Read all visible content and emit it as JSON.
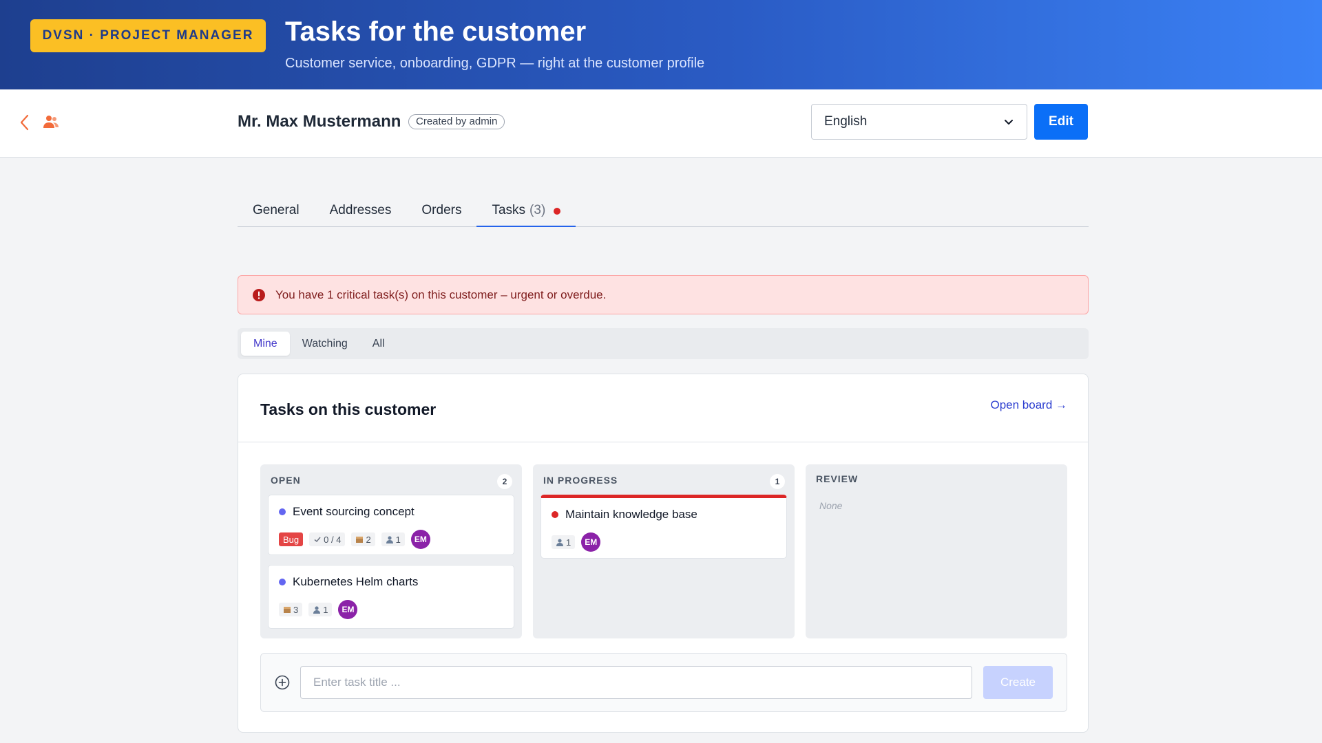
{
  "banner": {
    "brand": "DVSN · PROJECT MANAGER",
    "title": "Tasks for the customer",
    "subtitle": "Customer service, onboarding, GDPR — right at the customer profile"
  },
  "header": {
    "back_icon": "chevron-left-icon",
    "customer_icon": "users-icon",
    "customer_name": "Mr. Max Mustermann",
    "created_badge": "Created by admin",
    "language": "English",
    "edit_label": "Edit"
  },
  "tabs": [
    {
      "label": "General"
    },
    {
      "label": "Addresses"
    },
    {
      "label": "Orders"
    },
    {
      "label": "Tasks",
      "count": "(3)",
      "active": true
    }
  ],
  "alert": {
    "text": "You have 1 critical task(s) on this customer – urgent or overdue."
  },
  "filter": [
    {
      "label": "Mine",
      "active": true
    },
    {
      "label": "Watching"
    },
    {
      "label": "All"
    }
  ],
  "card": {
    "title": "Tasks on this customer",
    "open_board": "Open board →"
  },
  "columns": [
    {
      "name": "OPEN",
      "count": "2",
      "tasks": [
        {
          "title": "Event sourcing concept",
          "dot_color": "#6366f1",
          "tag": "Bug",
          "checklist": "0 / 4",
          "packages": "2",
          "people": "1",
          "avatar": "EM"
        },
        {
          "title": "Kubernetes Helm charts",
          "dot_color": "#6366f1",
          "packages": "3",
          "people": "1",
          "avatar": "EM"
        }
      ]
    },
    {
      "name": "IN PROGRESS",
      "count": "1",
      "tasks": [
        {
          "title": "Maintain knowledge base",
          "dot_color": "#dc2626",
          "critical": true,
          "people": "1",
          "avatar": "EM"
        }
      ]
    },
    {
      "name": "REVIEW",
      "empty": "None"
    }
  ],
  "create": {
    "placeholder": "Enter task title ...",
    "button": "Create"
  },
  "colors": {
    "accent": "#0b6ff7",
    "critical": "#dc2626",
    "brand_yellow": "#fbbf24"
  }
}
